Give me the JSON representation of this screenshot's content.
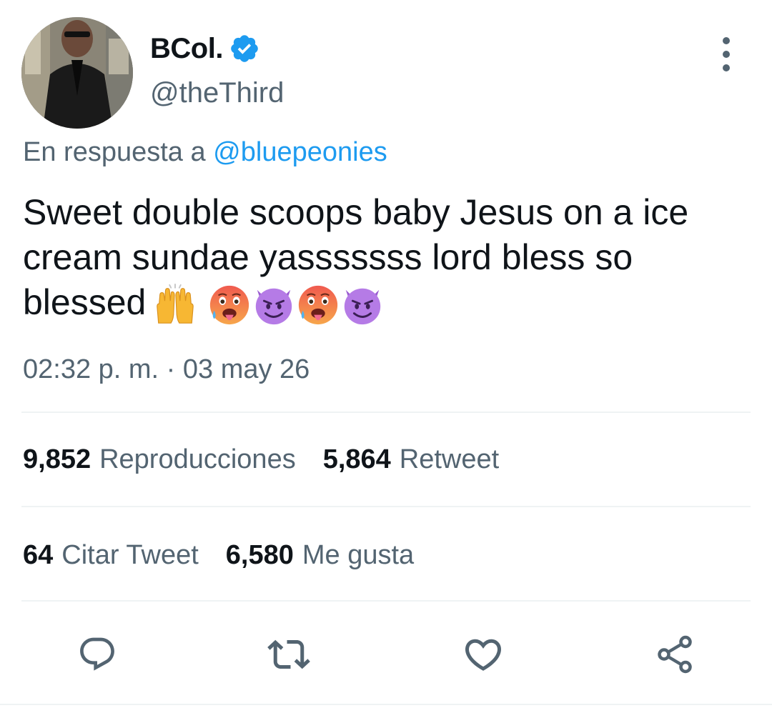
{
  "author": {
    "display_name": "BCol.",
    "handle": "@theThird",
    "verified": true
  },
  "reply": {
    "prefix": "En respuesta a",
    "to_handle": "@bluepeonies"
  },
  "tweet": {
    "text": "Sweet double scoops baby Jesus on a ice cream sundae yasssssss lord bless so blessed",
    "emojis": [
      "raising-hands-emoji",
      "hot-face-emoji",
      "smiling-devil-emoji",
      "hot-face-emoji",
      "smiling-devil-emoji"
    ],
    "timestamp": "02:32 p. m. · 03 may 26"
  },
  "stats": {
    "views_count": "9,852",
    "views_label": "Reproducciones",
    "retweets_count": "5,864",
    "retweets_label": "Retweet",
    "quotes_count": "64",
    "quotes_label": "Citar Tweet",
    "likes_count": "6,580",
    "likes_label": "Me gusta"
  },
  "actions": [
    "reply-icon",
    "retweet-icon",
    "like-icon",
    "share-icon"
  ],
  "colors": {
    "accent": "#1d9bf0",
    "secondary_text": "#536471",
    "primary_text": "#0f1419",
    "divider": "#eff3f4"
  }
}
